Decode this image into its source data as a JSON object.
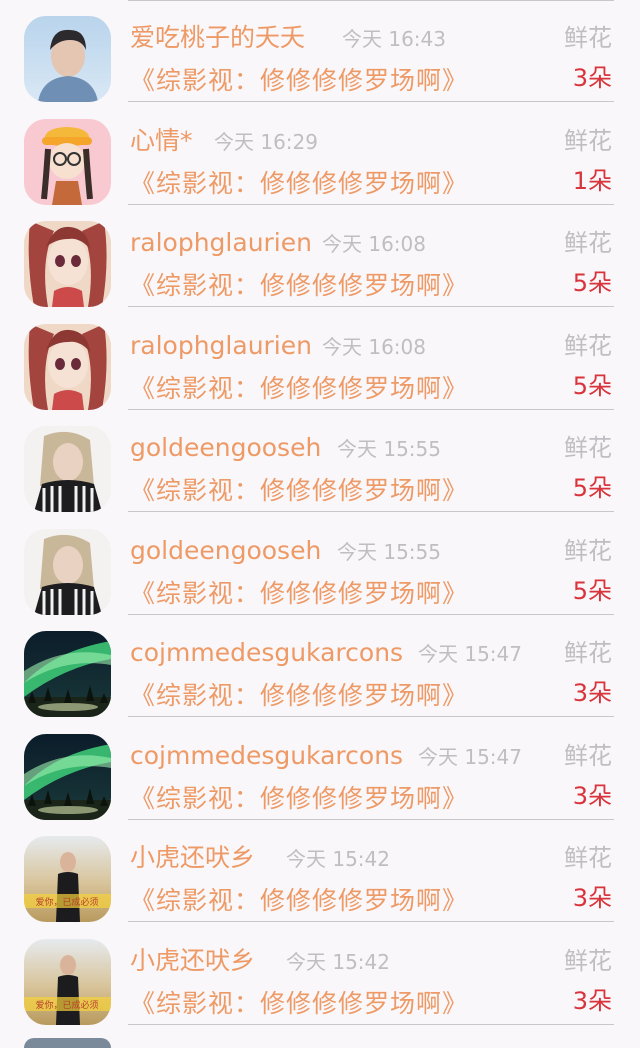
{
  "rows": [
    {
      "name": "爱吃桃子的夭夭",
      "time": "今天 16:43",
      "gift_label": "鲜花",
      "book": "《综影视：修修修修罗场啊》",
      "count": "3朵",
      "avatar": "boy-portrait"
    },
    {
      "name": "心情*",
      "time": "今天 16:29",
      "gift_label": "鲜花",
      "book": "《综影视：修修修修罗场啊》",
      "count": "1朵",
      "avatar": "cartoon-girl"
    },
    {
      "name": "ralophglaurien",
      "time": "今天 16:08",
      "gift_label": "鲜花",
      "book": "《综影视：修修修修罗场啊》",
      "count": "5朵",
      "avatar": "anime-girl"
    },
    {
      "name": "ralophglaurien",
      "time": "今天 16:08",
      "gift_label": "鲜花",
      "book": "《综影视：修修修修罗场啊》",
      "count": "5朵",
      "avatar": "anime-girl"
    },
    {
      "name": "goldeengooseh",
      "time": "今天 15:55",
      "gift_label": "鲜花",
      "book": "《综影视：修修修修罗场啊》",
      "count": "5朵",
      "avatar": "woman-portrait"
    },
    {
      "name": "goldeengooseh",
      "time": "今天 15:55",
      "gift_label": "鲜花",
      "book": "《综影视：修修修修罗场啊》",
      "count": "5朵",
      "avatar": "woman-portrait"
    },
    {
      "name": "cojmmedesgukarcons",
      "time": "今天 15:47",
      "gift_label": "鲜花",
      "book": "《综影视：修修修修罗场啊》",
      "count": "3朵",
      "avatar": "aurora"
    },
    {
      "name": "cojmmedesgukarcons",
      "time": "今天 15:47",
      "gift_label": "鲜花",
      "book": "《综影视：修修修修罗场啊》",
      "count": "3朵",
      "avatar": "aurora"
    },
    {
      "name": "小虎还吠乡",
      "time": "今天 15:42",
      "gift_label": "鲜花",
      "book": "《综影视：修修修修罗场啊》",
      "count": "3朵",
      "avatar": "boy-field",
      "avatar_text": "爱你，已成必须"
    },
    {
      "name": "小虎还吠乡",
      "time": "今天 15:42",
      "gift_label": "鲜花",
      "book": "《综影视：修修修修罗场啊》",
      "count": "3朵",
      "avatar": "boy-field",
      "avatar_text": "爱你，已成必须"
    }
  ]
}
